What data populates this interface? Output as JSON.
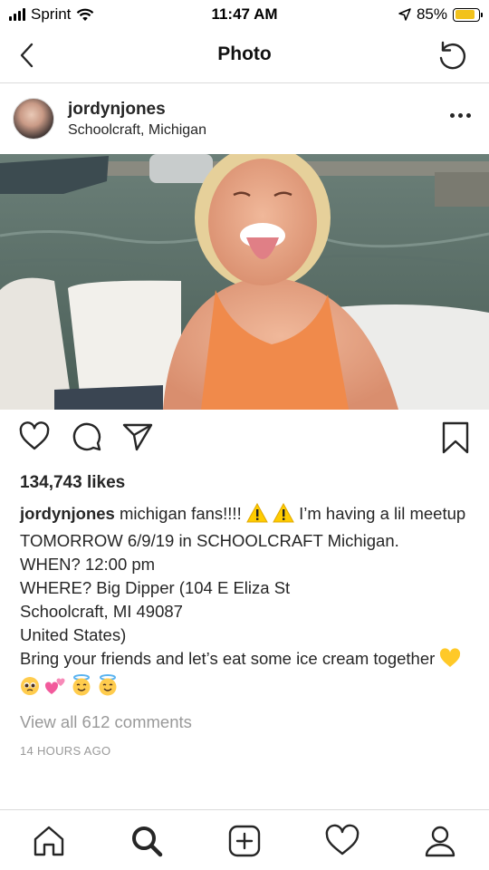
{
  "status_bar": {
    "carrier": "Sprint",
    "time": "11:47 AM",
    "battery_percent": "85%",
    "battery_level": 0.85,
    "battery_color": "#f2c21b"
  },
  "nav": {
    "title": "Photo",
    "back_icon": "chevron-left-icon",
    "refresh_icon": "refresh-icon"
  },
  "post": {
    "username": "jordynjones",
    "location": "Schoolcraft, Michigan",
    "likes": "134,743 likes",
    "caption": {
      "username": "jordynjones",
      "line1_before_emoji": " michigan fans!!!! ",
      "line1_after_emoji": " I’m having a lil meetup TOMORROW 6/9/19 in SCHOOLCRAFT Michigan.",
      "when": "WHEN? 12:00 pm",
      "where": "WHERE? Big Dipper (104 E Eliza St",
      "address": "Schoolcraft, MI  49087",
      "country": "United States)",
      "closing": "Bring your friends and let’s eat some ice cream together ",
      "emojis": [
        "yellow-heart",
        "pleading-face",
        "two-hearts",
        "smiling-face-with-halo",
        "smiling-face-with-halo"
      ]
    },
    "view_comments": "View all 612 comments",
    "timestamp": "14 HOURS AGO"
  },
  "actions": {
    "like_icon": "heart-icon",
    "comment_icon": "comment-icon",
    "share_icon": "share-icon",
    "save_icon": "bookmark-icon"
  },
  "tabs": [
    "home-icon",
    "search-icon",
    "add-icon",
    "activity-heart-icon",
    "profile-icon"
  ]
}
